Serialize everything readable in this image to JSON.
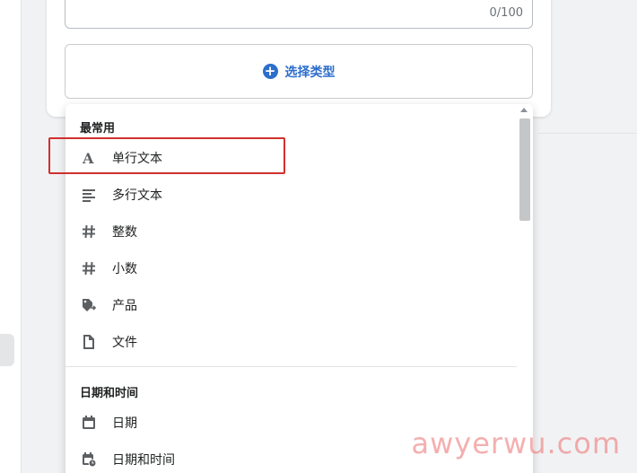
{
  "field": {
    "char_count": "0/100",
    "select_type_label": "选择类型"
  },
  "dropdown": {
    "sections": [
      {
        "title": "最常用",
        "items": [
          {
            "label": "单行文本",
            "icon": "text-a-icon",
            "highlighted": true
          },
          {
            "label": "多行文本",
            "icon": "multiline-text-icon"
          },
          {
            "label": "整数",
            "icon": "hash-icon"
          },
          {
            "label": "小数",
            "icon": "hash-icon"
          },
          {
            "label": "产品",
            "icon": "product-tag-icon"
          },
          {
            "label": "文件",
            "icon": "file-icon"
          }
        ]
      },
      {
        "title": "日期和时间",
        "items": [
          {
            "label": "日期",
            "icon": "calendar-icon"
          },
          {
            "label": "日期和时间",
            "icon": "calendar-clock-icon"
          }
        ]
      }
    ]
  },
  "watermark": "awyerwu.com",
  "colors": {
    "accent": "#2c6ecb",
    "highlight_border": "#d0302e",
    "text": "#202223",
    "muted": "#6d7175"
  }
}
